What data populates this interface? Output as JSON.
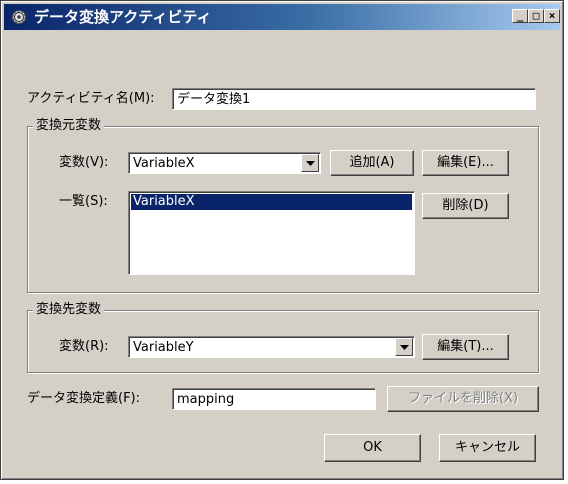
{
  "window": {
    "title": "データ変換アクティビティ",
    "minimize_label": "_",
    "maximize_label": "□",
    "close_label": "×"
  },
  "activity_name": {
    "label": "アクティビティ名(M):",
    "value": "データ変換1"
  },
  "source_group": {
    "title": "変換元変数",
    "variable_label": "変数(V):",
    "variable_value": "VariableX",
    "add_button": "追加(A)",
    "edit_button": "編集(E)...",
    "list_label": "一覧(S):",
    "list_items": [
      "VariableX"
    ],
    "delete_button": "削除(D)"
  },
  "target_group": {
    "title": "変換先変数",
    "variable_label": "変数(R):",
    "variable_value": "VariableY",
    "edit_button": "編集(T)..."
  },
  "definition": {
    "label": "データ変換定義(F):",
    "value": "mapping",
    "delete_file_button": "ファイルを削除(X)"
  },
  "footer": {
    "ok_button": "OK",
    "cancel_button": "キャンセル"
  }
}
